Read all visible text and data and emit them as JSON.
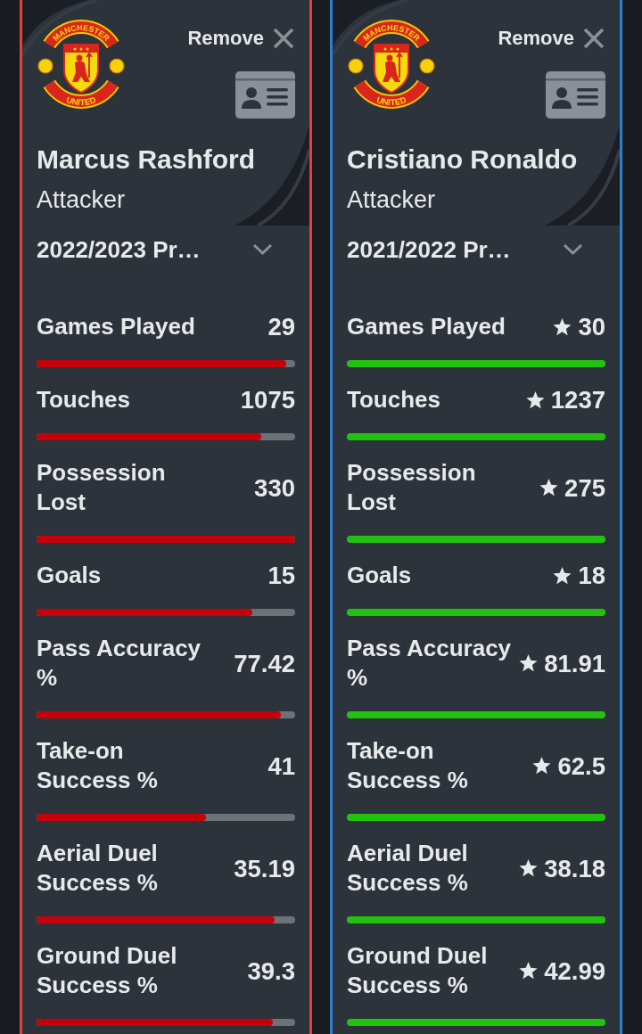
{
  "players": [
    {
      "color": "#e5403f",
      "crest": {
        "top_text": "MANCHESTER",
        "bottom_text": "UNITED"
      },
      "remove_button": {
        "label": "Remove"
      },
      "name": "Marcus Rashford",
      "position": "Attacker",
      "season": "2022/2023 Pr…",
      "stats": [
        {
          "label": "Games Played",
          "value": "29",
          "starred": false,
          "level": 0.967
        },
        {
          "label": "Touches",
          "value": "1075",
          "starred": false,
          "level": 0.869
        },
        {
          "label": "Possession Lost",
          "value": "330",
          "starred": false,
          "level": 1
        },
        {
          "label": "Goals",
          "value": "15",
          "starred": false,
          "level": 0.833
        },
        {
          "label": "Pass Accuracy %",
          "value": "77.42",
          "starred": false,
          "level": 0.945
        },
        {
          "label": "Take-on Success %",
          "value": "41",
          "starred": false,
          "level": 0.656
        },
        {
          "label": "Aerial Duel Success %",
          "value": "35.19",
          "starred": false,
          "level": 0.922
        },
        {
          "label": "Ground Duel Success %",
          "value": "39.3",
          "starred": false,
          "level": 0.914
        }
      ]
    },
    {
      "color": "#2e7fcf",
      "crest": {
        "top_text": "MANCHESTER",
        "bottom_text": "UNITED"
      },
      "remove_button": {
        "label": "Remove"
      },
      "name": "Cristiano Ronaldo",
      "position": "Attacker",
      "season": "2021/2022 Pr…",
      "stats": [
        {
          "label": "Games Played",
          "value": "30",
          "starred": true,
          "level": 1
        },
        {
          "label": "Touches",
          "value": "1237",
          "starred": true,
          "level": 1
        },
        {
          "label": "Possession Lost",
          "value": "275",
          "starred": true,
          "level": 1
        },
        {
          "label": "Goals",
          "value": "18",
          "starred": true,
          "level": 1
        },
        {
          "label": "Pass Accuracy %",
          "value": "81.91",
          "starred": true,
          "level": 1
        },
        {
          "label": "Take-on Success %",
          "value": "62.5",
          "starred": true,
          "level": 1
        },
        {
          "label": "Aerial Duel Success %",
          "value": "38.18",
          "starred": true,
          "level": 1
        },
        {
          "label": "Ground Duel Success %",
          "value": "42.99",
          "starred": true,
          "level": 1
        }
      ]
    }
  ]
}
